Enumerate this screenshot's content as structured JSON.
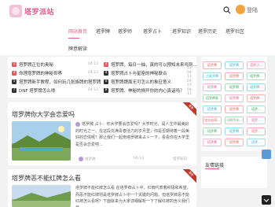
{
  "site": {
    "logo_text": "塔罗派站"
  },
  "header": {
    "login_label": "登陆"
  },
  "nav": {
    "items": [
      "网站首页",
      "塔罗牌",
      "塔罗师",
      "塔罗占卜",
      "塔罗知识",
      "塔罗历史",
      "塔罗社区",
      "牌意解读"
    ],
    "active_index": 0
  },
  "hot_list": [
    {
      "num": "1",
      "title": "塔罗牌正位的奥秘",
      "date": "04-13"
    },
    {
      "num": "3",
      "title": "命理塔罗牌的神秘世界",
      "date": "04-13"
    },
    {
      "num": "5",
      "title": "塔罗牌新手教程，如何玩几张族牌的塔罗牌",
      "date": "04-13"
    },
    {
      "num": "7",
      "title": "DNF 塔罗牌怎么得",
      "date": "04-13"
    },
    {
      "num": "2",
      "title": "塔罗牌，每日一抽，真的可以预知未来吗到...",
      "date": "04-13"
    },
    {
      "num": "4",
      "title": "塔罗牌占卜与星座的神秘联合",
      "date": "04-13"
    },
    {
      "num": "6",
      "title": "塔罗牌牌面无可怎么的象征意义",
      "date": "04-13"
    },
    {
      "num": "8",
      "title": "塔罗牌、神秘的揭开你的内心真话吗？",
      "date": "04-13"
    }
  ],
  "cards": [
    {
      "title": "塔罗牌你大学会恋爱吗",
      "excerpt": "塔罗牌 占卜：你大学要会恋爱吗？大学时光，是人生中最美好的时光之一。在这段充满青春活力的岁月里，你是否期待着一段美好的恋情呢？那让我们一起用塔罗牌来占卜一下，看看你在大学里是否会恋爱吧...",
      "ribbon": "推荐",
      "author": "塔罗牌",
      "views": "04-13",
      "category": "塔罗知识"
    },
    {
      "title": "塔罗牌恶不能红牌怎么看",
      "excerpt": "塔罗牌不能红牌怎么看 在塔罗牌占卜中，红牌代表着积极和希望，而恶不能红牌则是塔罗牌占卜中一个关键的问题。但塔罗牌恶不能红牌怎么看呢？下面就来为大家详细解析一下了解红牌的含义我们要...",
      "ribbon": "推荐"
    }
  ],
  "tags": [
    [
      "塔罗牌",
      "塔罗牌",
      "塔罗占..."
    ],
    [
      "占星术牌",
      "塔罗牌",
      "塔罗牌..."
    ],
    [
      "塔罗牌",
      "塔罗牌",
      "塔罗牌..."
    ],
    [
      "塔罗牌意",
      "塔罗牌",
      "塔罗牌..."
    ],
    [
      "塔罗牌",
      "塔罗牌",
      "塔罗..."
    ],
    [
      "张太仙塔...",
      "小阿尔卡...",
      "塔罗..."
    ],
    [
      "塔罗牌",
      "塔罗牌",
      "塔罗..."
    ],
    [
      "塔罗牌",
      "塔罗牌",
      "塔罗..."
    ]
  ],
  "sidebar": {
    "links_title": "友情链接"
  },
  "colors": {
    "accent": "#e25b8e",
    "ribbon": "#c0392b"
  }
}
